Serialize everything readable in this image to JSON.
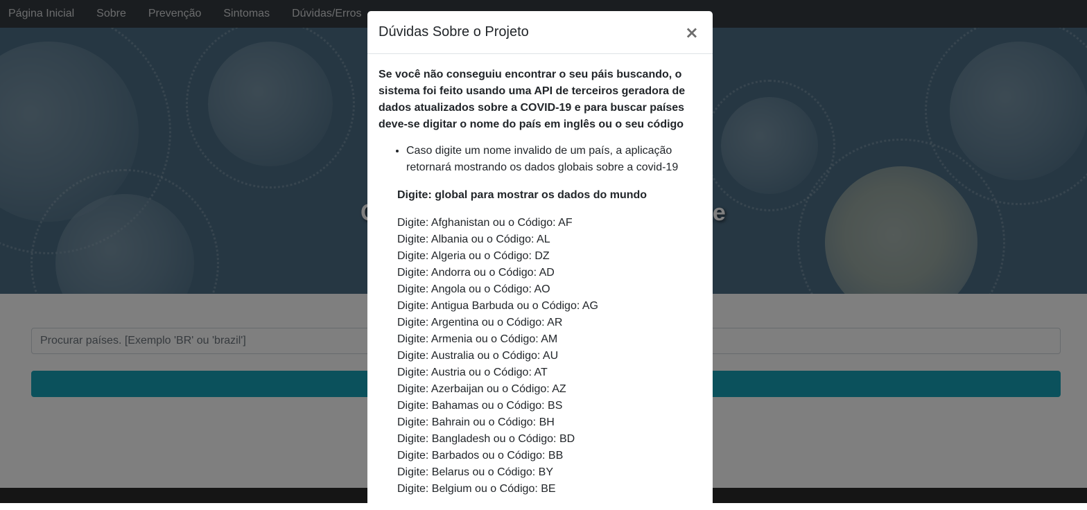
{
  "navbar": {
    "links": [
      "Página Inicial",
      "Sobre",
      "Prevenção",
      "Sintomas",
      "Dúvidas/Erros"
    ]
  },
  "hero": {
    "title_left": "C",
    "title_right": "te"
  },
  "search": {
    "placeholder": "Procurar países. [Exemplo 'BR' ou 'brazil']"
  },
  "modal": {
    "title": "Dúvidas Sobre o Projeto",
    "close_label": "×",
    "intro": "Se você não conseguiu encontrar o seu páis buscando, o sistema foi feito usando uma API de terceiros geradora de dados atualizados sobre a COVID-19 e para buscar países deve-se digitar o nome do país em inglês ou o seu código",
    "note": "Caso digite um nome invalido de um país, a aplicação retornará mostrando os dados globais sobre a covid-19",
    "global_hint": "Digite: global para mostrar os dados do mundo",
    "countries": [
      "Digite: Afghanistan ou o Código: AF",
      "Digite: Albania ou o Código: AL",
      "Digite: Algeria ou o Código: DZ",
      "Digite: Andorra ou o Código: AD",
      "Digite: Angola ou o Código: AO",
      "Digite: Antigua Barbuda ou o Código: AG",
      "Digite: Argentina ou o Código: AR",
      "Digite: Armenia ou o Código: AM",
      "Digite: Australia ou o Código: AU",
      "Digite: Austria ou o Código: AT",
      "Digite: Azerbaijan ou o Código: AZ",
      "Digite: Bahamas ou o Código: BS",
      "Digite: Bahrain ou o Código: BH",
      "Digite: Bangladesh ou o Código: BD",
      "Digite: Barbados ou o Código: BB",
      "Digite: Belarus ou o Código: BY",
      "Digite: Belgium ou o Código: BE"
    ]
  },
  "colors": {
    "navbar": "#343a40",
    "button": "#17a2b8",
    "hero": "#4c6e86"
  }
}
